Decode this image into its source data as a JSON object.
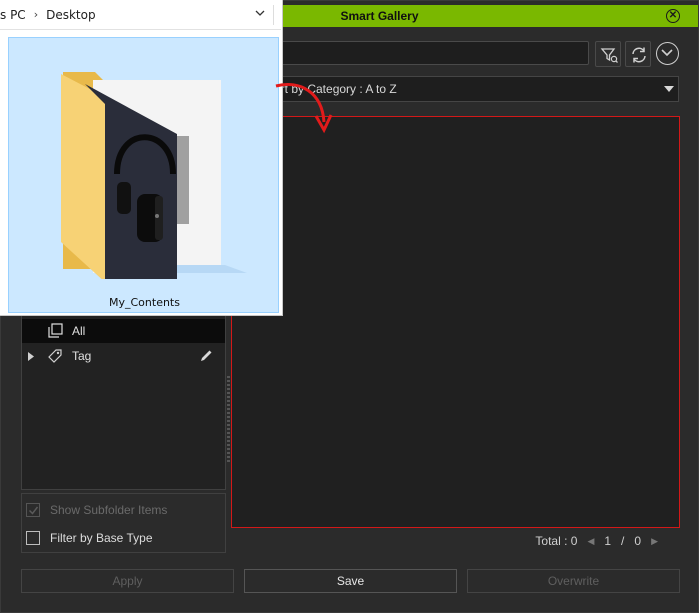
{
  "window": {
    "title": "Smart Gallery",
    "accent": "#7ab800",
    "highlight_border": "#d31818"
  },
  "sort": {
    "value": "ort by Category : A to Z"
  },
  "tree": {
    "items": [
      {
        "label": "All",
        "icon": "all-icon",
        "selected": true
      },
      {
        "label": "Tag",
        "icon": "tag-icon",
        "selected": false
      }
    ]
  },
  "options": {
    "show_subfolder": {
      "label": "Show Subfolder Items",
      "checked": true,
      "enabled": false
    },
    "filter_base_type": {
      "label": "Filter by Base Type",
      "checked": false,
      "enabled": true
    }
  },
  "status": {
    "total": "Total : 0",
    "page": "1",
    "page_sep": "/",
    "page_total": "0"
  },
  "buttons": {
    "apply": "Apply",
    "save": "Save",
    "overwrite": "Overwrite"
  },
  "explorer": {
    "breadcrumb": [
      "s PC",
      "Desktop"
    ],
    "folder_name": "My_Contents"
  }
}
